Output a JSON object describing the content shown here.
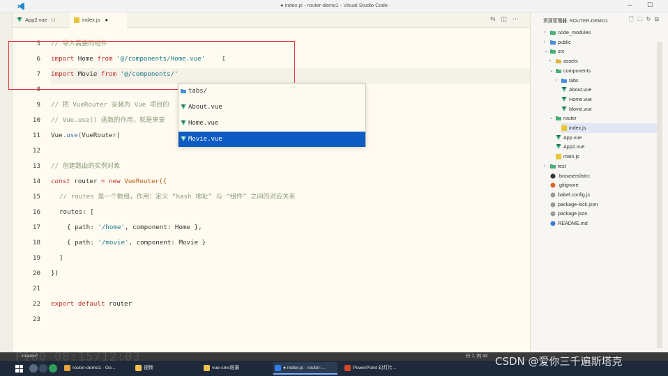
{
  "window": {
    "title": "● index.js - router-demo1 - Visual Studio Code",
    "minimize": "─",
    "maximize": "☐"
  },
  "tabs": [
    {
      "label": "App2.vue",
      "badge": "U"
    },
    {
      "label": "index.js",
      "badge": "●"
    }
  ],
  "editor": {
    "lines": [
      {
        "n": "5",
        "text": "// 导入需要的组件"
      },
      {
        "n": "6",
        "text": "import Home from '@/components/Home.vue'"
      },
      {
        "n": "7",
        "text": "import Movie from '@/components/'"
      },
      {
        "n": "8",
        "text": ""
      },
      {
        "n": "9",
        "text": "// 把 VueRouter 安装为 Vue 项目的"
      },
      {
        "n": "10",
        "text": "// Vue.use() 函数的作用，就是来安"
      },
      {
        "n": "11",
        "text": "Vue.use(VueRouter)"
      },
      {
        "n": "12",
        "text": ""
      },
      {
        "n": "13",
        "text": "// 创建路由的实例对象"
      },
      {
        "n": "14",
        "text": "const router = new VueRouter({"
      },
      {
        "n": "15",
        "text": "// routes 是一个数组，作用：定义 “hash 地址” 与 “组件” 之间的对应关系"
      },
      {
        "n": "16",
        "text": "routes: ["
      },
      {
        "n": "17",
        "text": "{ path: '/home', component: Home },"
      },
      {
        "n": "18",
        "text": "{ path: '/movie', component: Movie }"
      },
      {
        "n": "19",
        "text": "]"
      },
      {
        "n": "20",
        "text": "})"
      },
      {
        "n": "21",
        "text": ""
      },
      {
        "n": "22",
        "text": "export default router"
      },
      {
        "n": "23",
        "text": ""
      }
    ],
    "tokens": {
      "import": "import",
      "from": "from",
      "home": "Home",
      "movie": "Movie",
      "home_path": "'@/components/Home.vue'",
      "movie_path": "'@/components/'",
      "vue": "Vue",
      "use": ".use(",
      "vuerouter": "VueRouter",
      "close_paren": ")",
      "const": "const",
      "router": "router",
      "eq": "=",
      "new": "new",
      "vr_call": "VueRouter({",
      "routes_key": "routes: [",
      "obj_open": "{ path:",
      "home_route": "'/home'",
      "movie_route": "'/movie'",
      "comp_home": ", component: Home },",
      "comp_movie": ", component: Movie }",
      "bracket_close": "]",
      "brace_close": "})",
      "export": "export",
      "default": "default",
      "cursor": "I"
    }
  },
  "suggestions": [
    {
      "label": "tabs/",
      "kind": "folder"
    },
    {
      "label": "About.vue",
      "kind": "vue"
    },
    {
      "label": "Home.vue",
      "kind": "vue"
    },
    {
      "label": "Movie.vue",
      "kind": "vue",
      "selected": true
    }
  ],
  "explorer": {
    "header": "资源管理器: ROUTER-DEMO1",
    "items": [
      {
        "label": "node_modules",
        "depth": 0,
        "chevron": ">",
        "kind": "folder-green"
      },
      {
        "label": "public",
        "depth": 0,
        "chevron": ">",
        "kind": "folder-blue"
      },
      {
        "label": "src",
        "depth": 0,
        "chevron": "v",
        "kind": "folder-green"
      },
      {
        "label": "assets",
        "depth": 1,
        "chevron": ">",
        "kind": "folder-yellow"
      },
      {
        "label": "components",
        "depth": 1,
        "chevron": "v",
        "kind": "folder-green"
      },
      {
        "label": "tabs",
        "depth": 2,
        "chevron": ">",
        "kind": "folder-blue"
      },
      {
        "label": "About.vue",
        "depth": 2,
        "chevron": "",
        "kind": "vue"
      },
      {
        "label": "Home.vue",
        "depth": 2,
        "chevron": "",
        "kind": "vue"
      },
      {
        "label": "Movie.vue",
        "depth": 2,
        "chevron": "",
        "kind": "vue"
      },
      {
        "label": "router",
        "depth": 1,
        "chevron": "v",
        "kind": "folder-green"
      },
      {
        "label": "index.js",
        "depth": 2,
        "chevron": "",
        "kind": "js",
        "selected": true
      },
      {
        "label": "App.vue",
        "depth": 1,
        "chevron": "",
        "kind": "vue"
      },
      {
        "label": "App2.vue",
        "depth": 1,
        "chevron": "",
        "kind": "vue"
      },
      {
        "label": "main.js",
        "depth": 1,
        "chevron": "",
        "kind": "js"
      },
      {
        "label": "test",
        "depth": 0,
        "chevron": ">",
        "kind": "folder-green"
      },
      {
        "label": ".browserslistrc",
        "depth": 0,
        "chevron": "",
        "kind": "dot-dark"
      },
      {
        "label": ".gitignore",
        "depth": 0,
        "chevron": "",
        "kind": "dot-orange"
      },
      {
        "label": "babel.config.js",
        "depth": 0,
        "chevron": "",
        "kind": "dot-gray"
      },
      {
        "label": "package-lock.json",
        "depth": 0,
        "chevron": "",
        "kind": "dot-gray"
      },
      {
        "label": "package.json",
        "depth": 0,
        "chevron": "",
        "kind": "dot-gray"
      },
      {
        "label": "README.md",
        "depth": 0,
        "chevron": "",
        "kind": "dot-blue"
      }
    ]
  },
  "statusbar": {
    "branch": "master*",
    "position": "行 7, 列 33"
  },
  "taskbar": {
    "buttons": [
      {
        "label": "router-demo1 - Go...",
        "color": "#e8a23a"
      },
      {
        "label": "视频",
        "color": "#f2c14e"
      },
      {
        "label": "vue-cms效果",
        "color": "#f2c14e"
      },
      {
        "label": "● index.js - router-...",
        "color": "#2f80ed",
        "active": true
      },
      {
        "label": "PowerPoint 幻灯片...",
        "color": "#d24726"
      }
    ]
  },
  "watermarks": {
    "csdn": "CSDN @爱你三千遍斯塔克",
    "video": "P180 08:15/12:03"
  },
  "colors": {
    "accent_blue": "#0f5bc4",
    "highlight_red": "#e53535",
    "vue_green": "#41b883",
    "editor_bg": "#fffbf0"
  }
}
